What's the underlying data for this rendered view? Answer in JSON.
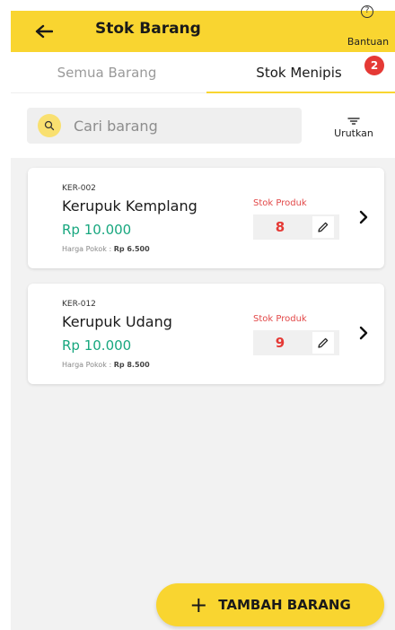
{
  "header": {
    "title": "Stok Barang",
    "help_label": "Bantuan"
  },
  "tabs": [
    {
      "label": "Semua Barang",
      "active": false
    },
    {
      "label": "Stok Menipis",
      "active": true,
      "badge": "2"
    }
  ],
  "search": {
    "placeholder": "Cari barang"
  },
  "sort": {
    "label": "Urutkan"
  },
  "products": [
    {
      "code": "KER-002",
      "name": "Kerupuk Kemplang",
      "price": "Rp 10.000",
      "cost_label": "Harga Pokok : ",
      "cost_value": "Rp 6.500",
      "stock_label": "Stok Produk",
      "stock_value": "8"
    },
    {
      "code": "KER-012",
      "name": "Kerupuk Udang",
      "price": "Rp 10.000",
      "cost_label": "Harga Pokok : ",
      "cost_value": "Rp 8.500",
      "stock_label": "Stok Produk",
      "stock_value": "9"
    }
  ],
  "fab": {
    "label": "TAMBAH BARANG"
  },
  "colors": {
    "accent": "#f9d530",
    "price": "#18a77f",
    "stock": "#e53935",
    "badge": "#e53935"
  },
  "icons": [
    "back-arrow-icon",
    "help-icon",
    "search-icon",
    "sort-icon",
    "edit-pencil-icon",
    "chevron-right-icon",
    "plus-icon"
  ]
}
